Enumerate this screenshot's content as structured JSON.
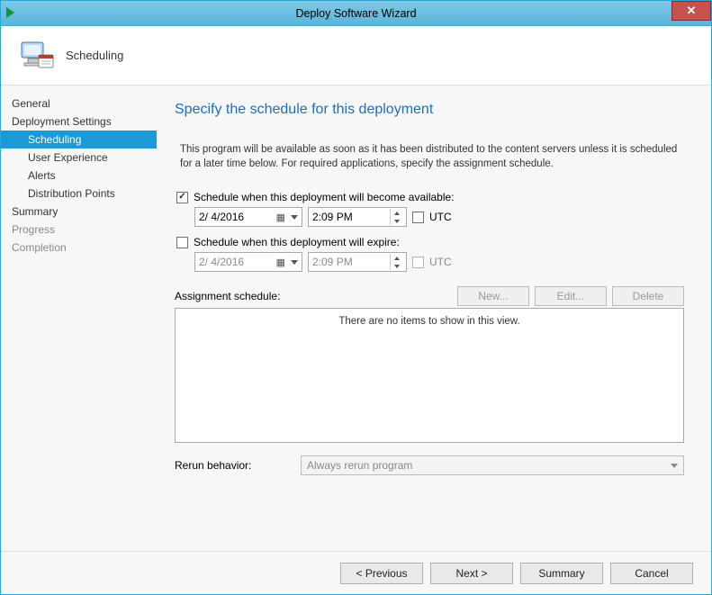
{
  "window": {
    "title": "Deploy Software Wizard"
  },
  "header": {
    "title": "Scheduling"
  },
  "sidebar": {
    "items": [
      {
        "label": "General",
        "cls": "top"
      },
      {
        "label": "Deployment Settings",
        "cls": "top"
      },
      {
        "label": "Scheduling",
        "cls": "sub selected"
      },
      {
        "label": "User Experience",
        "cls": "sub"
      },
      {
        "label": "Alerts",
        "cls": "sub"
      },
      {
        "label": "Distribution Points",
        "cls": "sub"
      },
      {
        "label": "Summary",
        "cls": "top"
      },
      {
        "label": "Progress",
        "cls": "top dim"
      },
      {
        "label": "Completion",
        "cls": "top dim"
      }
    ]
  },
  "main": {
    "page_title": "Specify the schedule for this deployment",
    "description": "This program will be available as soon as it has been distributed to the content servers unless it is scheduled for a later time below. For required applications, specify the assignment schedule.",
    "avail": {
      "label": "Schedule when this deployment will become available:",
      "checked": true,
      "date": "2/ 4/2016",
      "time": "2:09 PM",
      "utc_label": "UTC",
      "utc_checked": false
    },
    "expire": {
      "label": "Schedule when this deployment will expire:",
      "checked": false,
      "date": "2/ 4/2016",
      "time": "2:09 PM",
      "utc_label": "UTC",
      "utc_checked": false
    },
    "assignment": {
      "label": "Assignment schedule:",
      "new_btn": "New...",
      "edit_btn": "Edit...",
      "delete_btn": "Delete",
      "empty_msg": "There are no items to show in this view."
    },
    "rerun": {
      "label": "Rerun behavior:",
      "value": "Always rerun program"
    }
  },
  "footer": {
    "previous": "< Previous",
    "next": "Next >",
    "summary": "Summary",
    "cancel": "Cancel"
  }
}
